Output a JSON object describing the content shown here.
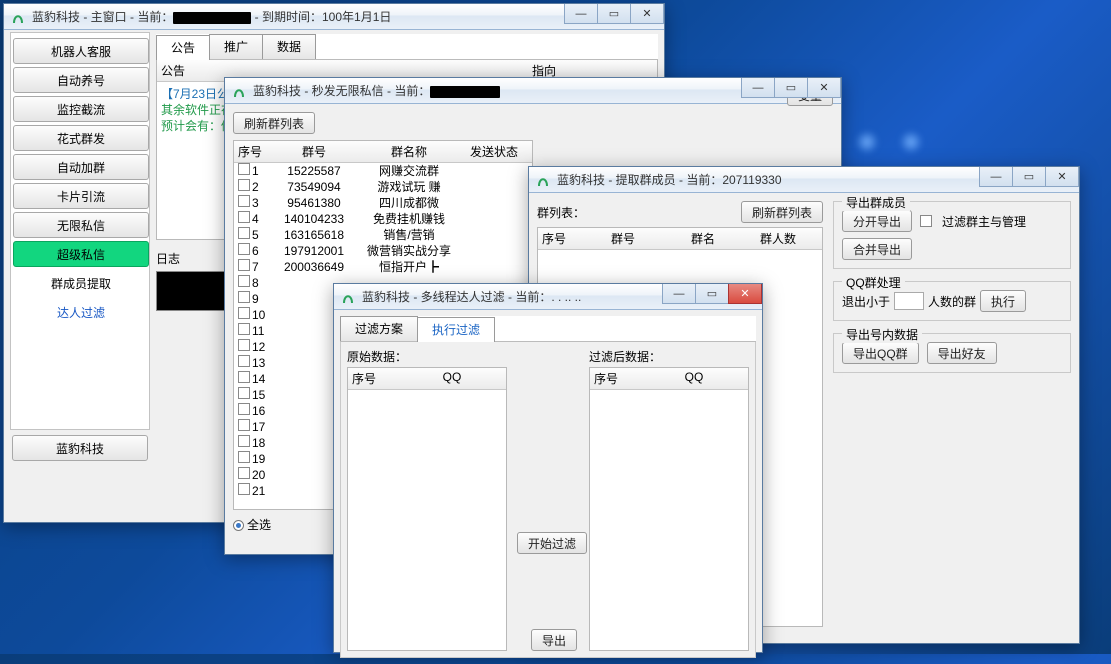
{
  "main_window": {
    "title_prefix": "蓝豹科技 - 主窗口 - 当前：",
    "title_blackout_width": 78,
    "title_suffix": " - 到期时间：100年1月1日",
    "sidebar": {
      "items": [
        {
          "label": "机器人客服",
          "kind": "btn"
        },
        {
          "label": "自动养号",
          "kind": "btn"
        },
        {
          "label": "监控截流",
          "kind": "btn"
        },
        {
          "label": "花式群发",
          "kind": "btn"
        },
        {
          "label": "自动加群",
          "kind": "btn"
        },
        {
          "label": "卡片引流",
          "kind": "btn"
        },
        {
          "label": "无限私信",
          "kind": "btn"
        },
        {
          "label": "超级私信",
          "kind": "green"
        },
        {
          "label": "群成员提取",
          "kind": "plain"
        },
        {
          "label": "达人过滤",
          "kind": "link"
        }
      ],
      "footer_label": "蓝豹科技"
    },
    "tabs": [
      {
        "label": "公告"
      },
      {
        "label": "推广"
      },
      {
        "label": "数据"
      }
    ],
    "active_tab": 0,
    "table_headers": [
      "公告",
      "指向"
    ],
    "announcement_lines": [
      {
        "text": "【7月23日公告】",
        "color": "#1b6fb3"
      },
      {
        "text": "其余软件正在开发",
        "color": "#219a4a"
      },
      {
        "text": "预计会有：修改Q",
        "color": "#219a4a"
      }
    ],
    "log_label": "日志"
  },
  "send_window": {
    "title_prefix": "蓝豹科技 - 秒发无限私信 - 当前：",
    "title_blackout_width": 70,
    "refresh_btn": "刷新群列表",
    "variable_btn": "变量",
    "headers": [
      "序号",
      "群号",
      "群名称",
      "发送状态"
    ],
    "rows": [
      {
        "idx": "1",
        "gid": "15225587",
        "name": "网赚交流群"
      },
      {
        "idx": "2",
        "gid": "73549094",
        "name": "游戏试玩  赚"
      },
      {
        "idx": "3",
        "gid": "95461380",
        "name": "四川成都微"
      },
      {
        "idx": "4",
        "gid": "140104233",
        "name": "免费挂机赚钱"
      },
      {
        "idx": "5",
        "gid": "163165618",
        "name": "销售/营销"
      },
      {
        "idx": "6",
        "gid": "197912001",
        "name": "微营销实战分享"
      },
      {
        "idx": "7",
        "gid": "200036649",
        "name": "恒指开户┣"
      },
      {
        "idx": "8",
        "gid": "",
        "name": ""
      },
      {
        "idx": "9",
        "gid": "",
        "name": ""
      },
      {
        "idx": "10",
        "gid": "",
        "name": ""
      },
      {
        "idx": "11",
        "gid": "",
        "name": ""
      },
      {
        "idx": "12",
        "gid": "",
        "name": ""
      },
      {
        "idx": "13",
        "gid": "",
        "name": ""
      },
      {
        "idx": "14",
        "gid": "",
        "name": ""
      },
      {
        "idx": "15",
        "gid": "",
        "name": ""
      },
      {
        "idx": "16",
        "gid": "",
        "name": ""
      },
      {
        "idx": "17",
        "gid": "",
        "name": ""
      },
      {
        "idx": "18",
        "gid": "",
        "name": ""
      },
      {
        "idx": "19",
        "gid": "",
        "name": ""
      },
      {
        "idx": "20",
        "gid": "",
        "name": ""
      },
      {
        "idx": "21",
        "gid": "",
        "name": ""
      }
    ],
    "select_all_label": "全选"
  },
  "extract_window": {
    "title_prefix": "蓝豹科技 - 提取群成员 - 当前：",
    "title_current": "207119330",
    "group_list_label": "群列表：",
    "refresh_btn": "刷新群列表",
    "headers": [
      "序号",
      "群号",
      "群名",
      "群人数"
    ],
    "export_members": {
      "title": "导出群成员",
      "split_btn": "分开导出",
      "merge_btn": "合并导出",
      "filter_label": "过滤群主与管理"
    },
    "qq_group_handle": {
      "title": "QQ群处理",
      "prefix": "退出小于",
      "suffix": "人数的群",
      "exec_btn": "执行"
    },
    "export_account": {
      "title": "导出号内数据",
      "export_qq_btn": "导出QQ群",
      "export_friend_btn": "导出好友"
    }
  },
  "filter_window": {
    "title_prefix": "蓝豹科技 - 多线程达人过滤 - 当前：",
    "title_ellipsis": ". .  .. ..",
    "tabs": [
      {
        "label": "过滤方案"
      },
      {
        "label": "执行过滤"
      }
    ],
    "active_tab": 1,
    "raw_label": "原始数据：",
    "filtered_label": "过滤后数据：",
    "col_headers": [
      "序号",
      "QQ"
    ],
    "start_btn": "开始过滤",
    "export_btn": "导出"
  },
  "win_controls": {
    "min": "—",
    "max": "▭",
    "close": "✕"
  }
}
